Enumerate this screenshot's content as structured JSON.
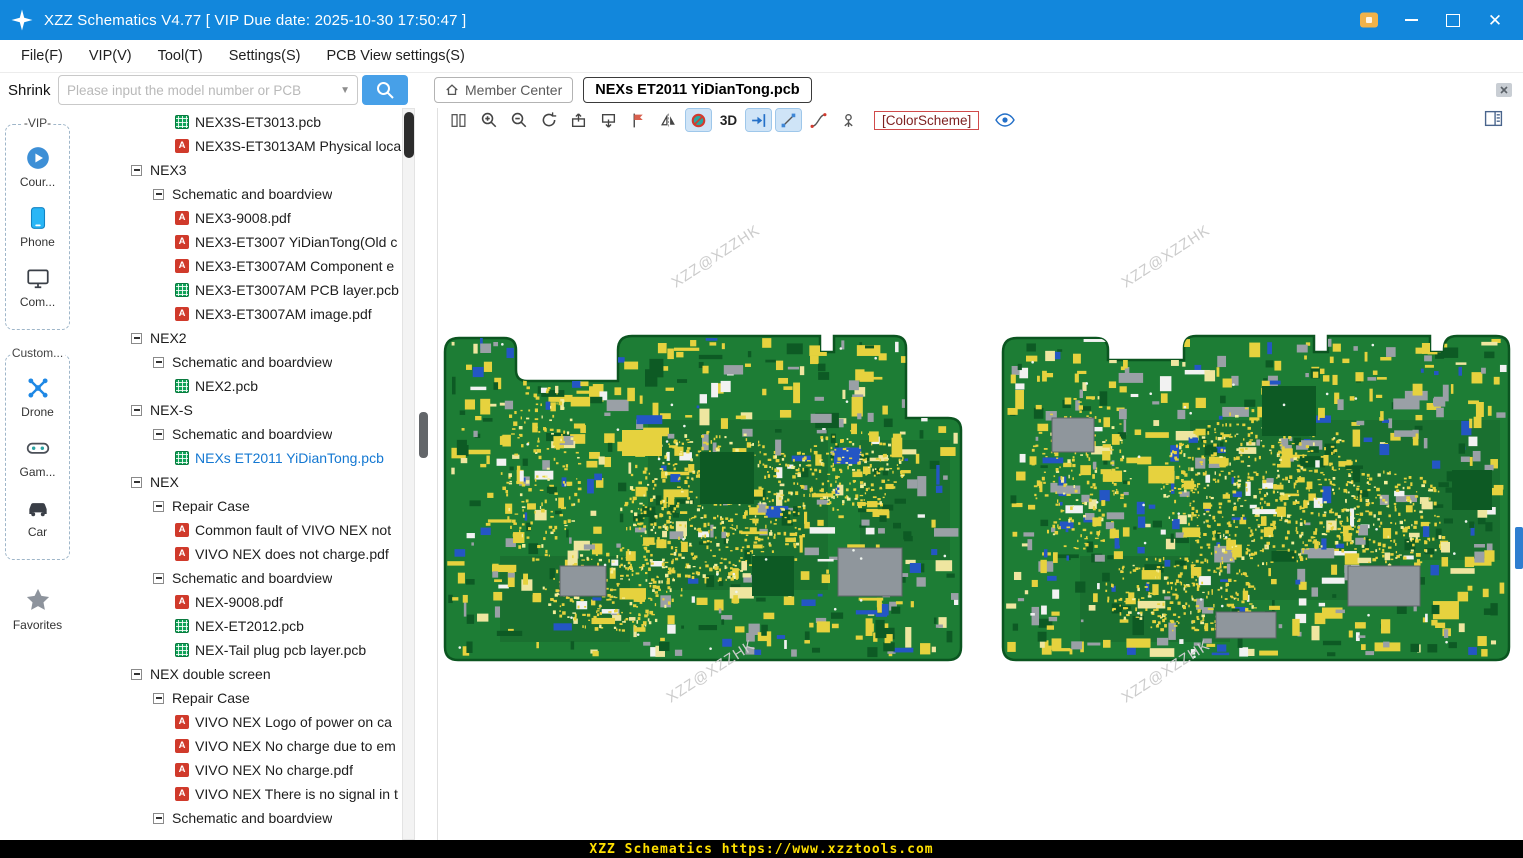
{
  "window": {
    "title": "XZZ Schematics V4.77 [ VIP Due date: 2025-10-30 17:50:47 ]"
  },
  "menu": {
    "items": [
      "File(F)",
      "VIP(V)",
      "Tool(T)",
      "Settings(S)",
      "PCB View settings(S)"
    ]
  },
  "search": {
    "shrink": "Shrink",
    "placeholder": "Please input the model number or PCB"
  },
  "header": {
    "member_center": "Member Center",
    "tab": "NEXs ET2011 YiDianTong.pcb"
  },
  "pcb_toolbar": {
    "threed": "3D",
    "colorscheme": "[ColorScheme]"
  },
  "sidebar": {
    "groups": [
      {
        "label": "-VIP-",
        "items": [
          {
            "label": "Cour...",
            "icon": "play-icon"
          },
          {
            "label": "Phone",
            "icon": "phone-icon"
          },
          {
            "label": "Com...",
            "icon": "computer-icon"
          }
        ]
      },
      {
        "label": "Custom...",
        "items": [
          {
            "label": "Drone",
            "icon": "drone-icon"
          },
          {
            "label": "Gam...",
            "icon": "gamepad-icon"
          },
          {
            "label": "Car",
            "icon": "car-icon"
          }
        ]
      }
    ],
    "favorites": {
      "label": "Favorites",
      "icon": "star-icon"
    }
  },
  "tree": {
    "items": [
      {
        "label": "NEX3S-ET3013.pcb",
        "type": "pcb",
        "level": 3
      },
      {
        "label": "NEX3S-ET3013AM Physical loca",
        "type": "pdf",
        "level": 3
      },
      {
        "label": "NEX3",
        "type": "branch",
        "level": 1
      },
      {
        "label": "Schematic and boardview",
        "type": "branch",
        "level": 2
      },
      {
        "label": "NEX3-9008.pdf",
        "type": "pdf",
        "level": 3
      },
      {
        "label": "NEX3-ET3007 YiDianTong(Old c",
        "type": "pdf",
        "level": 3
      },
      {
        "label": "NEX3-ET3007AM Component e",
        "type": "pdf",
        "level": 3
      },
      {
        "label": "NEX3-ET3007AM PCB layer.pcb",
        "type": "pcb",
        "level": 3
      },
      {
        "label": "NEX3-ET3007AM image.pdf",
        "type": "pdf",
        "level": 3
      },
      {
        "label": "NEX2",
        "type": "branch",
        "level": 1
      },
      {
        "label": "Schematic and boardview",
        "type": "branch",
        "level": 2
      },
      {
        "label": "NEX2.pcb",
        "type": "pcb",
        "level": 3
      },
      {
        "label": "NEX-S",
        "type": "branch",
        "level": 1
      },
      {
        "label": "Schematic and boardview",
        "type": "branch",
        "level": 2
      },
      {
        "label": "NEXs ET2011 YiDianTong.pcb",
        "type": "pcb",
        "level": 3,
        "selected": true
      },
      {
        "label": "NEX",
        "type": "branch",
        "level": 1
      },
      {
        "label": "Repair Case",
        "type": "branch",
        "level": 2
      },
      {
        "label": "Common fault of VIVO NEX not",
        "type": "pdf",
        "level": 3
      },
      {
        "label": "VIVO NEX does not charge.pdf",
        "type": "pdf",
        "level": 3
      },
      {
        "label": "Schematic and boardview",
        "type": "branch",
        "level": 2
      },
      {
        "label": "NEX-9008.pdf",
        "type": "pdf",
        "level": 3
      },
      {
        "label": "NEX-ET2012.pcb",
        "type": "pcb",
        "level": 3
      },
      {
        "label": "NEX-Tail plug pcb layer.pcb",
        "type": "pcb",
        "level": 3
      },
      {
        "label": "NEX double screen",
        "type": "branch",
        "level": 1
      },
      {
        "label": "Repair Case",
        "type": "branch",
        "level": 2
      },
      {
        "label": "VIVO NEX Logo of power on ca",
        "type": "pdf",
        "level": 3
      },
      {
        "label": "VIVO NEX No charge due to em",
        "type": "pdf",
        "level": 3
      },
      {
        "label": "VIVO NEX No charge.pdf",
        "type": "pdf",
        "level": 3
      },
      {
        "label": "VIVO NEX There is no signal in t",
        "type": "pdf",
        "level": 3
      },
      {
        "label": "Schematic and boardview",
        "type": "branch",
        "level": 2
      }
    ]
  },
  "canvas": {
    "watermark": "XZZ@XZZHK"
  },
  "statusbar": {
    "text": "XZZ Schematics https://www.xzztools.com"
  },
  "colors": {
    "titlebar": "#1287dc",
    "accent": "#47a0e8",
    "board_green": "#1d7d35",
    "component_yellow": "#e6d23e",
    "status_text": "#ffe000",
    "selected_text": "#1478d2",
    "colorscheme_border": "#d04a4a"
  }
}
